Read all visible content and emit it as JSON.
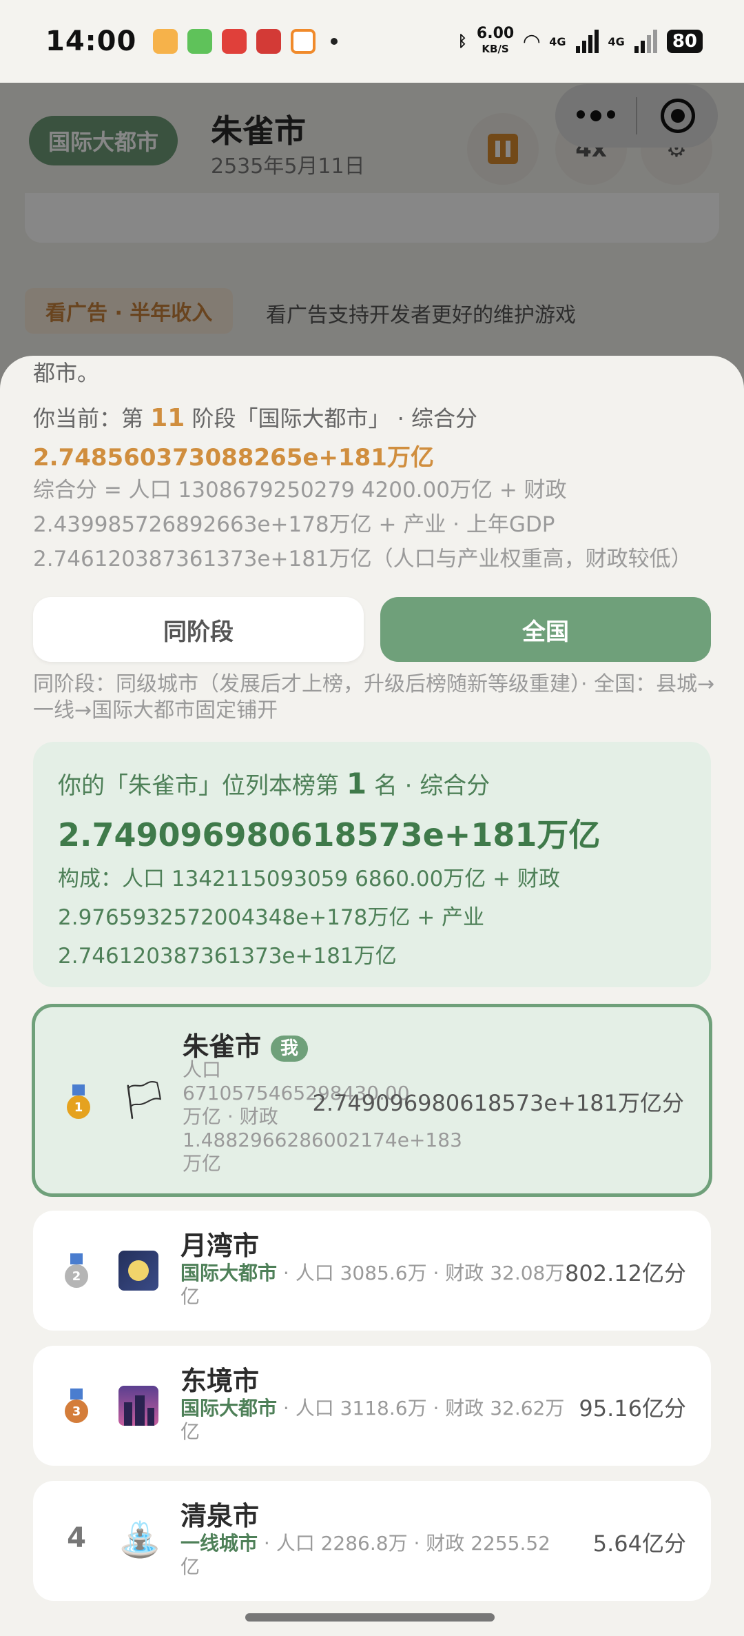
{
  "status_bar": {
    "time": "14:00",
    "net_speed": "6.00",
    "net_unit": "KB/S",
    "signal1": "4G",
    "signal2": "4G",
    "battery": "80"
  },
  "background": {
    "tier_pill": "国际大都市",
    "city_name": "朱雀市",
    "date": "2535年5月11日",
    "speed": "4x",
    "ad_chip": "看广告 · 半年收入",
    "ad_text": "看广告支持开发者更好的维护游戏"
  },
  "sheet": {
    "cut_text": "都市。",
    "stage_prefix": "你当前：第",
    "stage_num": "11",
    "stage_suffix": "阶段「国际大都市」 · 综合分",
    "composite_score": "2.748560373088265e+181万亿",
    "formula": "综合分 = 人口 1308679250279 4200.00万亿 + 财政 2.439985726892663e+178万亿 + 产业 · 上年GDP 2.746120387361373e+181万亿（人口与产业权重高，财政较低）",
    "tabs": {
      "same_stage": "同阶段",
      "national": "全国"
    },
    "tab_note": "同阶段：同级城市（发展后才上榜，升级后榜随新等级重建）· 全国：县城→一线→国际大都市固定铺开",
    "my_rank": {
      "prefix": "你的「朱雀市」位列本榜第",
      "rank": "1",
      "suffix": "名 · 综合分",
      "score": "2.749096980618573e+181万亿",
      "composition": "构成：人口 1342115093059 6860.00万亿 + 财政 2.9765932572004348e+178万亿 + 产业 2.746120387361373e+181万亿"
    }
  },
  "rankings": [
    {
      "rank": "1",
      "name": "朱雀市",
      "badge": "我",
      "tier": "",
      "sub": "人口 6710575465298430.00万亿 · 财政 1.4882966286002174e+183万亿",
      "score": "2.749096980618573e+181万亿分"
    },
    {
      "rank": "2",
      "name": "月湾市",
      "tier": "国际大都市",
      "sub": " · 人口 3085.6万 · 财政 32.08万亿",
      "score": "802.12亿分"
    },
    {
      "rank": "3",
      "name": "东境市",
      "tier": "国际大都市",
      "sub": " · 人口 3118.6万 · 财政 32.62万亿",
      "score": "95.16亿分"
    },
    {
      "rank": "4",
      "name": "清泉市",
      "tier": "一线城市",
      "sub": " · 人口 2286.8万 · 财政 2255.52亿",
      "score": "5.64亿分"
    }
  ],
  "colors": {
    "accent_green": "#6fa07a",
    "accent_orange": "#d08e3e"
  }
}
